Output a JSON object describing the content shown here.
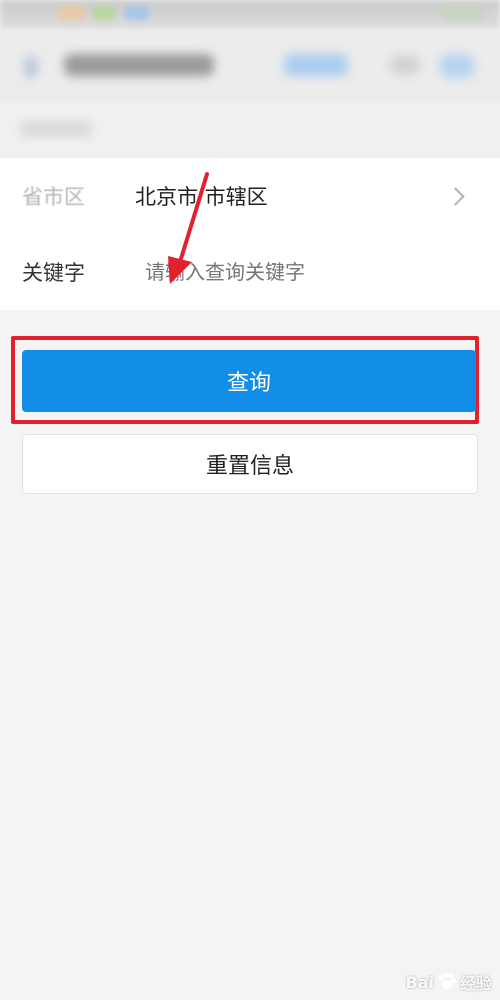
{
  "form": {
    "province_label": "省市区",
    "province_value": "北京市 市辖区",
    "keyword_label": "关键字",
    "keyword_placeholder": "请输入查询关键字",
    "keyword_value": ""
  },
  "buttons": {
    "query_label": "查询",
    "reset_label": "重置信息"
  },
  "watermark": {
    "text_left": "Bai",
    "text_right": "经验"
  },
  "colors": {
    "primary": "#128ee9",
    "highlight": "#e3212e",
    "background": "#f4f4f4"
  },
  "icons": {
    "province_row_chevron": "chevron-right-icon",
    "annotation_arrow": "arrow-down-icon"
  }
}
